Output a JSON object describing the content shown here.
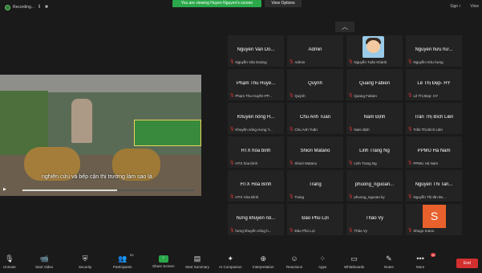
{
  "recording": {
    "label": "Recording..."
  },
  "share_banner": "You are viewing Huyen Nguyen's screen",
  "view_options": "View Options",
  "top_right": {
    "sign_label": "Sign r",
    "view_label": "View"
  },
  "video": {
    "subtitle": "nghiên cứu và bếp cận thị trường làm sao lá",
    "progress": 0.55
  },
  "participants": [
    {
      "name": "Nguyen Van Do...",
      "sub": "Nguyễn Văn Đoàng"
    },
    {
      "name": "Admin",
      "sub": "Admin"
    },
    {
      "name": "",
      "sub": "Nguyễn Tuấn Khánh",
      "avatar": "image"
    },
    {
      "name": "Nguyễn hữu hư...",
      "sub": "Nguyễn Hữu hưng"
    },
    {
      "name": "Phạm Thu Huyề...",
      "sub": "Phạm Thu Huyền-PP..."
    },
    {
      "name": "Quỳnh",
      "sub": "Quỳnh"
    },
    {
      "name": "Quang Fabien",
      "sub": "Quang Fabien"
    },
    {
      "name": "Lê Thị Đẹp- HY",
      "sub": "Lê Thị Đẹp- HY"
    },
    {
      "name": "Khuyến nông H...",
      "sub": "Khuyến nông Hưng Y..."
    },
    {
      "name": "Chu Anh Tuấn",
      "sub": "Chu Anh Tuấn"
    },
    {
      "name": "Nam Định",
      "sub": "Nam định"
    },
    {
      "name": "Trần Thị Bích Liên",
      "sub": "Trần Thị Bích Liên"
    },
    {
      "name": "HTX hòa bình",
      "sub": "HTX hòa bình"
    },
    {
      "name": "Shiori Matano",
      "sub": "Shiori Matano"
    },
    {
      "name": "Linh Trang Ng",
      "sub": "Linh Trang Ng"
    },
    {
      "name": "PPMU Hà Nam",
      "sub": "PPMU Hà Nam"
    },
    {
      "name": "HTX Hòa Bình",
      "sub": "HTX Hòa Bình"
    },
    {
      "name": "Trang",
      "sub": "Trang"
    },
    {
      "name": "phuong_nguoan...",
      "sub": "phuong_nguoan ky"
    },
    {
      "name": "Nguyen Thi Tan...",
      "sub": "Nguyễn Thị tân Bx..."
    },
    {
      "name": "hưng khuyến nô...",
      "sub": "hưng khuyến nông h..."
    },
    {
      "name": "Đào Phú Lợi",
      "sub": "Đào Phú Lợi"
    },
    {
      "name": "Thảo Vy",
      "sub": "Thảo Vy"
    },
    {
      "name": "",
      "sub": "Shugo Kotoo",
      "avatar": "S"
    }
  ],
  "toolbar": {
    "unmute": "Unmute",
    "start_video": "Start Video",
    "security": "Security",
    "participants": "Participants",
    "participants_count": "53",
    "share_screen": "Share Screen",
    "start_summary": "Start Summary",
    "ai_companion": "AI Companion",
    "interpretation": "Interpretation",
    "reactions": "Reactions",
    "apps": "Apps",
    "whiteboards": "Whiteboards",
    "notes": "Notes",
    "more": "More",
    "more_badge": "10",
    "end": "End"
  },
  "colors": {
    "accent_green": "#2aa84a",
    "end_red": "#d32f2f",
    "avatar_orange": "#e8612c"
  }
}
